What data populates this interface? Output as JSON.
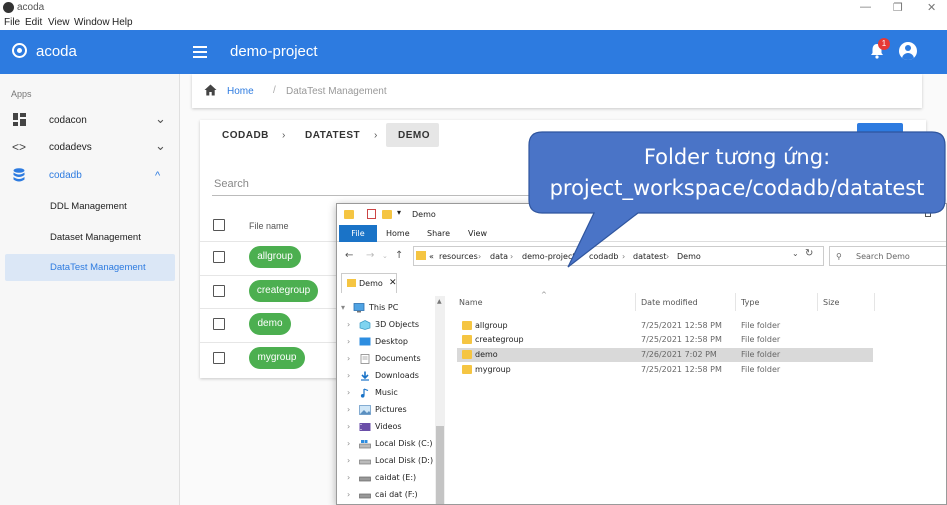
{
  "window": {
    "title": "acoda",
    "controls": [
      "—",
      "❐",
      "✕"
    ]
  },
  "menubar": [
    "File",
    "Edit",
    "View",
    "Window",
    "Help"
  ],
  "sidebar": {
    "app_name": "acoda",
    "section_label": "Apps",
    "items": [
      {
        "label": "codacon",
        "icon": "dashboard-icon",
        "expanded": false
      },
      {
        "label": "codadevs",
        "icon": "code-icon",
        "expanded": false
      },
      {
        "label": "codadb",
        "icon": "database-icon",
        "expanded": true
      }
    ],
    "sub_items": [
      {
        "label": "DDL Management",
        "active": false
      },
      {
        "label": "Dataset Management",
        "active": false
      },
      {
        "label": "DataTest Management",
        "active": true
      }
    ]
  },
  "header": {
    "title": "demo-project",
    "notification_count": "1"
  },
  "breadcrumb": {
    "home": "Home",
    "separator": "/",
    "current": "DataTest Management"
  },
  "path": {
    "segments": [
      "CODADB",
      "DATATEST",
      "DEMO"
    ]
  },
  "search": {
    "placeholder": "Search"
  },
  "table": {
    "column_name": "File name",
    "rows": [
      "allgroup",
      "creategroup",
      "demo",
      "mygroup"
    ]
  },
  "explorer": {
    "title": "Demo",
    "ribbon_tabs": [
      "File",
      "Home",
      "Share",
      "View"
    ],
    "address": [
      "«",
      "resources",
      "data",
      "demo-project",
      "codadb",
      "datatest",
      "Demo"
    ],
    "search_placeholder": "Search Demo",
    "tab_label": "Demo",
    "nav": [
      {
        "label": "This PC",
        "icon": "pc-icon"
      },
      {
        "label": "3D Objects",
        "icon": "3d-objects-icon"
      },
      {
        "label": "Desktop",
        "icon": "desktop-icon"
      },
      {
        "label": "Documents",
        "icon": "documents-icon"
      },
      {
        "label": "Downloads",
        "icon": "downloads-icon"
      },
      {
        "label": "Music",
        "icon": "music-icon"
      },
      {
        "label": "Pictures",
        "icon": "pictures-icon"
      },
      {
        "label": "Videos",
        "icon": "videos-icon"
      },
      {
        "label": "Local Disk (C:)",
        "icon": "disk-icon"
      },
      {
        "label": "Local Disk (D:)",
        "icon": "disk-icon"
      },
      {
        "label": "caidat (E:)",
        "icon": "disk-icon"
      },
      {
        "label": "cai dat (F:)",
        "icon": "disk-icon"
      }
    ],
    "columns": [
      "Name",
      "Date modified",
      "Type",
      "Size"
    ],
    "files": [
      {
        "name": "allgroup",
        "date": "7/25/2021 12:58 PM",
        "type": "File folder",
        "selected": false
      },
      {
        "name": "creategroup",
        "date": "7/25/2021 12:58 PM",
        "type": "File folder",
        "selected": false
      },
      {
        "name": "demo",
        "date": "7/26/2021 7:02 PM",
        "type": "File folder",
        "selected": true
      },
      {
        "name": "mygroup",
        "date": "7/25/2021 12:58 PM",
        "type": "File folder",
        "selected": false
      }
    ]
  },
  "callout": {
    "line1": "Folder tương ứng:",
    "line2": "project_workspace/codadb/datatest"
  },
  "colors": {
    "primary": "#2d7be0",
    "chip_green": "#4caf50",
    "callout_fill": "#4a74c7",
    "badge_red": "#e53935",
    "folder_yellow": "#f5c542"
  }
}
